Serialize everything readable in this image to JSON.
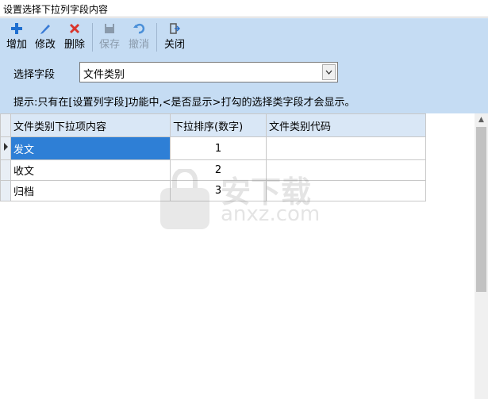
{
  "window": {
    "title": "设置选择下拉列字段内容"
  },
  "toolbar": {
    "add": "增加",
    "edit": "修改",
    "delete": "删除",
    "save": "保存",
    "undo": "撤消",
    "close": "关闭"
  },
  "field_select": {
    "label": "选择字段",
    "value": "文件类别"
  },
  "hint": "提示:只有在[设置列字段]功能中,<是否显示>打勾的选择类字段才会显示。",
  "grid": {
    "columns": [
      "文件类别下拉项内容",
      "下拉排序(数字)",
      "文件类别代码"
    ],
    "rows": [
      {
        "content": "发文",
        "order": "1",
        "code": ""
      },
      {
        "content": "收文",
        "order": "2",
        "code": ""
      },
      {
        "content": "归档",
        "order": "3",
        "code": ""
      }
    ]
  },
  "watermark": {
    "text": "安下载",
    "sub": "anxz.com"
  },
  "colors": {
    "band": "#c5dcf3",
    "selection": "#2e7fd6",
    "header": "#d9e7f6"
  },
  "icons": [
    "plus-icon",
    "pencil-icon",
    "x-icon",
    "save-icon",
    "undo-icon",
    "exit-icon",
    "dropdown-arrow-icon"
  ]
}
